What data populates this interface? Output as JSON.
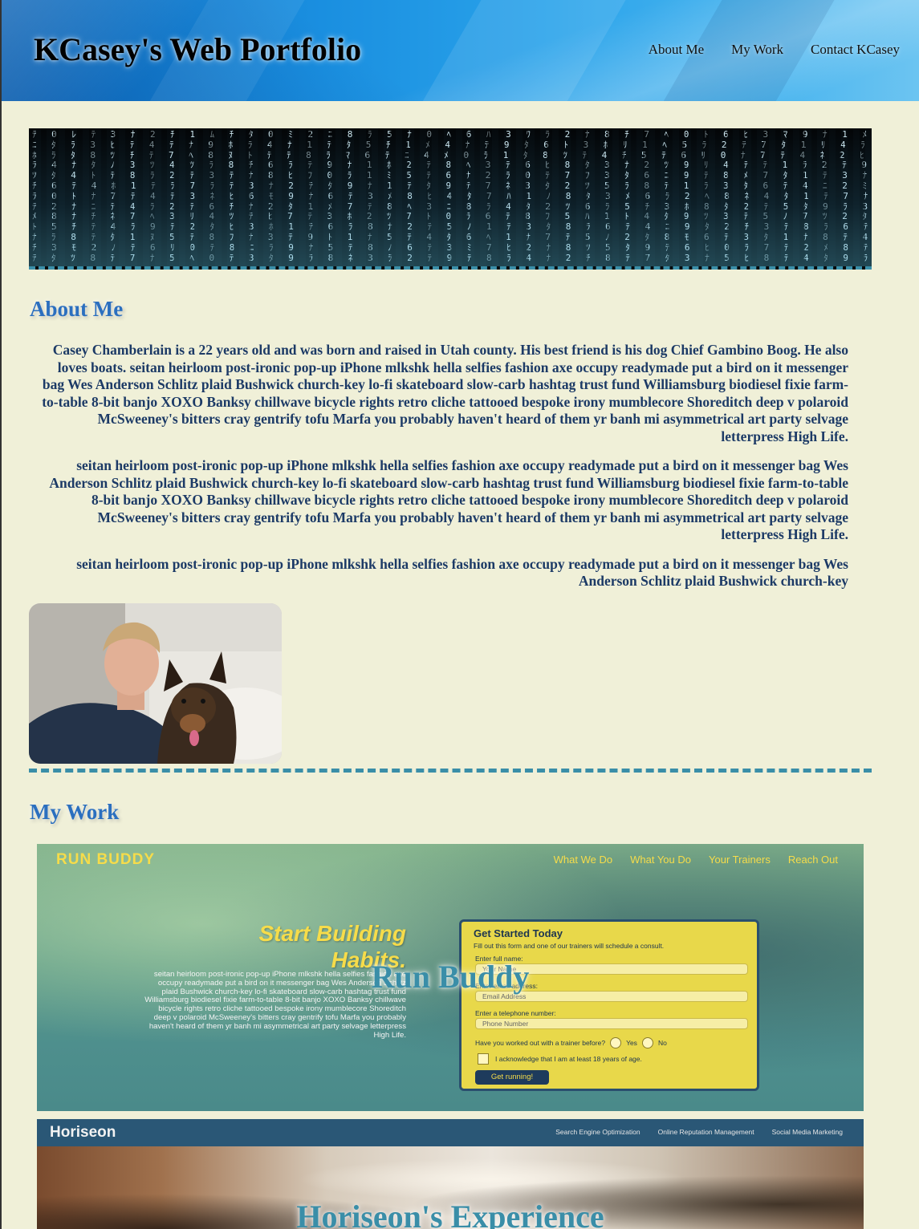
{
  "header": {
    "title": "KCasey's Web Portfolio",
    "nav": [
      "About Me",
      "My Work",
      "Contact KCasey"
    ]
  },
  "banner": {
    "rows": [
      "ﾃ 0 ﾚ ﾃ 3 ﾅ 2 ﾁ 1 ﾑ ﾁ ﾀ 0 ﾐ 2 ﾆ 8 ﾗ 5 ﾅ 0 ﾍ 6 ﾊ 3 ﾜ ﾗ 2 ﾅ 8 ﾁ 7 ﾍ 0 ﾄ 6 ﾋ 3 ﾏ 9 ﾅ 1 ﾒ 7 ﾅ 0 ﾎ 8 ﾂ 2 ﾅ ﾆ 1 ﾀ 8 ﾓ 3 ﾃ 6 ﾅ 9 ﾘ",
      "ﾆ ﾀ ﾗ 3 ﾋ ﾃ 4 ﾃ ﾅ 9 ﾎ ﾗ 4 ﾅ 1 ﾃ ﾀ 5 ﾁ 1 ﾒ 4 ﾅ ﾃ 9 ﾀ 6 ﾄ 3 ﾎ ﾘ 1 ﾍ 5 ﾗ 2 ﾃ 7 ﾀ 1 ﾘ 4 ﾗ 9 ﾄ 2 ﾃ 7 ﾁ 1 ﾆ 3 ﾐ 8 ﾘ 1 ﾃ 6 ﾀ 2",
      "ﾎ ﾗ ﾀ 8 ﾂ ﾁ ﾃ 7 ﾍ 8 ﾇ ﾄ ﾃ ﾃ 8 ﾗ ﾏ 6 ﾃ ﾆ 4 ﾒ 0 ﾗ 1 ﾀ 8 ﾂ ﾃ 4 ﾁ 5 ﾃ 6 ﾘ 0 ﾅ 7 ﾃ 4 ﾈ 2 ﾋ 3 ﾀ 6 ﾃ 3 ﾅ 5 ﾑ 8 ﾋ 6 ﾗ ﾀ ﾏ 3 ﾂ",
      "ﾗ 4 ﾅ ﾀ ﾉ 3 ﾂ 4 ﾂ ﾗ 8 ﾁ 6 ﾗ ﾃ 9 ﾅ 1 ﾎ 2 ﾃ 8 ﾍ 3 ﾃ 6 ﾋ 8 ﾀ 3 ﾅ 2 ﾂ 9 ﾘ 4 ﾃ ﾃ 1 ﾗ 2 ﾃ 9 ﾆ 0 ﾃ 4 ﾗ 8 ﾃ 5 ﾂ 7 ﾗ 4 ﾀ 1 ﾎ 6",
      "ﾂ ﾀ 4 ﾄ ﾃ 8 ﾗ 2 ﾃ 3 ﾃ ﾅ 8 ﾋ ﾌ 0 ﾗ 1 ﾐ 5 ﾃ 6 ﾅ 2 ﾗ 0 ﾃ 7 ﾌ 3 ﾀ 6 ﾆ 9 ﾃ 8 ﾒ 7 ﾀ 1 ﾃ 3 ﾅ 5 ﾘ 8 ﾃ 2 ﾃ 6 ﾓ 1 ﾃ 9 ﾀ 3 ﾒ 8",
      "ﾁ 6 ﾃ 4 ﾎ 1 ﾃ ﾗ 7 ﾗ ﾃ 3 ﾅ 2 ﾃ ﾀ 9 ﾅ 1 ﾃ ﾀ 9 ﾃ 7 ﾈ 3 ﾀ 2 ﾂ 5 ﾗ 8 ﾃ 1 ﾗ 3 ﾀ 6 ﾃ 4 ﾆ 2 ﾐ 7 ﾁ 1 ﾃ 6 ﾍ 9 ﾃ 2 ﾗ 8 ﾃ 4 ﾅ",
      "ﾗ 0 ﾄ ﾅ 7 ﾃ 4 ﾃ 3 ﾈ ﾋ 6 ﾓ 9 ﾅ 6 ﾃ 3 ﾒ 8 ﾋ 4 ﾀ 7 ﾊ 1 ﾉ 8 ﾀ 3 ﾒ 6 ﾗ 2 ﾍ 8 ﾈ 4 ﾀ 1 ﾃ 7 ﾅ 6 ﾀ 2 ﾁ 9 ﾃ 3 ﾀ 6 ﾓ 2 ﾆ 4 ﾘ 0",
      "ﾃ 2 ﾅ ﾆ ﾃ 4 ﾗ 2 ﾃ 6 ﾁ ﾅ 2 ﾀ 1 ﾒ 7 ﾃ 8 ﾍ 3 ﾆ 8 ﾗ 4 ﾀ 2 ﾂ 6 ﾗ 5 ﾁ 3 ﾎ 8 ﾀ 2 ﾃ 5 ﾀ 9 ﾗ 3 ﾃ 6 ﾀ 1 ﾃ 5 ﾌ 2 ﾅ 9 ﾁ 3 ﾈ 6",
      "ﾒ 8 ﾅ ﾁ ﾈ 7 ﾍ 3 ﾘ 4 ﾂ ﾃ ﾋ 7 ﾃ 3 ﾎ 2 ﾂ 7 ﾄ 0 ﾗ 6 ﾃ 8 ﾌ 5 ﾊ 1 ﾄ 4 ﾀ 9 ﾂ 3 ﾃ 5 ﾉ 7 ﾂ 2 ﾀ 9 ﾅ 6 ﾃ 1 ﾀ 3 ﾈ 5 ﾗ 6 ﾍ 7",
      "ﾄ 5 ﾁ ﾃ 4 ﾗ 9 ﾃ 2 ﾀ ﾋ 3 ﾎ 1 ﾃ 6 ﾗ 8 ﾅ 2 ﾃ 5 ﾉ 1 ﾃ 3 ﾀ 8 ﾗ 6 ﾃ 4 ﾆ 9 ﾀ 2 ﾁ 3 ﾃ 8 ﾗ 6 ﾃ 5 ﾀ 7 ﾅ 0 ﾃ 2 ﾁ 4 ﾀ 8 ﾗ 6",
      "ﾅ ﾗ 8 ﾃ ﾀ 1 ﾇ 5 ﾃ 8 ﾌ ﾅ 3 ﾃ 9 ﾄ 1 ﾅ 5 ﾃ 4 ﾀ 6 ﾍ 1 ﾅ 7 ﾃ 5 ﾉ 2 ﾀ 8 ﾓ 6 ﾃ 3 ﾀ 1 ﾅ 8 ﾃ 4 ﾈ 0 ﾃ 5 ﾀ 8 ﾉ 3 ﾂ 9 ﾀ 1 ﾌ 7",
      "ﾁ 3 ﾓ 2 ﾉ ﾃ 6 ﾘ 0 ﾃ 8 ﾆ ﾗ 9 ﾅ 5 ﾃ 8 ﾉ 6 ﾃ 3 ﾐ 7 ﾋ 2 ﾅ 8 ﾂ 5 ﾀ 9 ﾃ 6 ﾋ 0 ﾗ 7 ﾃ 2 ﾒ 8 ﾃ 5 ﾋ 9 ﾃ 6 ﾁ 4 ﾀ 2 ﾗ 8 ﾃ 0",
      "ﾃ ﾀ ﾂ 8 ﾃ 7 ﾅ 5 ﾍ 0 ﾃ 3 ﾀ 9 ﾗ 8 ﾈ 3 ﾗ 2 ﾃ 9 ﾃ 8 ﾗ 4 ﾅ 2 ﾁ 8 ﾃ 7 ﾀ 3 ﾅ 5 ﾋ 8 ﾃ 4 ﾀ 9 ﾗ 6 ﾃ 3 ﾁ 6 ﾗ 9 ﾆ 2 ﾅ 5 ﾃ 7"
    ]
  },
  "about": {
    "heading": "About Me",
    "paragraphs": [
      "Casey Chamberlain is a 22 years old and was born and raised in Utah county. His best friend is his dog Chief Gambino Boog. He also loves boats. seitan heirloom post-ironic pop-up iPhone mlkshk hella selfies fashion axe occupy readymade put a bird on it messenger bag Wes Anderson Schlitz plaid Bushwick church-key lo-fi skateboard slow-carb hashtag trust fund Williamsburg biodiesel fixie farm-to-table 8-bit banjo XOXO Banksy chillwave bicycle rights retro cliche tattooed bespoke irony mumblecore Shoreditch deep v polaroid McSweeney's bitters cray gentrify tofu Marfa you probably haven't heard of them yr banh mi asymmetrical art party selvage letterpress High Life.",
      "seitan heirloom post-ironic pop-up iPhone mlkshk hella selfies fashion axe occupy readymade put a bird on it messenger bag Wes Anderson Schlitz plaid Bushwick church-key lo-fi skateboard slow-carb hashtag trust fund Williamsburg biodiesel fixie farm-to-table 8-bit banjo XOXO Banksy chillwave bicycle rights retro cliche tattooed bespoke irony mumblecore Shoreditch deep v polaroid McSweeney's bitters cray gentrify tofu Marfa you probably haven't heard of them yr banh mi asymmetrical art party selvage letterpress High Life.",
      "seitan heirloom post-ironic pop-up iPhone mlkshk hella selfies fashion axe occupy readymade put a bird on it messenger bag Wes Anderson Schlitz plaid Bushwick church-key"
    ]
  },
  "work": {
    "heading": "My Work",
    "projects": [
      {
        "title": "Run Buddy",
        "screenshot": {
          "logo": "RUN BUDDY",
          "nav": [
            "What We Do",
            "What You Do",
            "Your Trainers",
            "Reach Out"
          ],
          "hero": [
            "Start Building",
            "Habits."
          ],
          "blurb": "seitan heirloom post-ironic pop-up iPhone mlkshk hella selfies fashion axe occupy readymade put a bird on it messenger bag Wes Anderson Schlitz plaid Bushwick church-key lo-fi skateboard slow-carb hashtag trust fund Williamsburg biodiesel fixie farm-to-table 8-bit banjo XOXO Banksy chillwave bicycle rights retro cliche tattooed bespoke irony mumblecore Shoreditch deep v polaroid McSweeney's bitters cray gentrify tofu Marfa you probably haven't heard of them yr banh mi asymmetrical art party selvage letterpress High Life.",
          "form": {
            "title": "Get Started Today",
            "subtitle": "Fill out this form and one of our trainers will schedule a consult.",
            "name_label": "Enter full name:",
            "name_placeholder": "Your Name",
            "email_label": "Enter email address:",
            "email_placeholder": "Email Address",
            "phone_label": "Enter a telephone number:",
            "phone_placeholder": "Phone Number",
            "radio_question": "Have you worked out with a trainer before?",
            "radio_yes": "Yes",
            "radio_no": "No",
            "checkbox_label": "I acknowledge that I am at least 18 years of age.",
            "button": "Get running!"
          }
        }
      },
      {
        "title": "Horiseon's Experience",
        "screenshot": {
          "logo": "Horiseon",
          "nav": [
            "Search Engine Optimization",
            "Online Reputation Management",
            "Social Media Marketing"
          ]
        }
      }
    ]
  },
  "colors": {
    "background": "#f0f0d8",
    "heading_blue": "#2b6fbf",
    "about_text": "#1c3a66",
    "divider": "#3a8ea8",
    "work_title": "#3a8ea8"
  }
}
